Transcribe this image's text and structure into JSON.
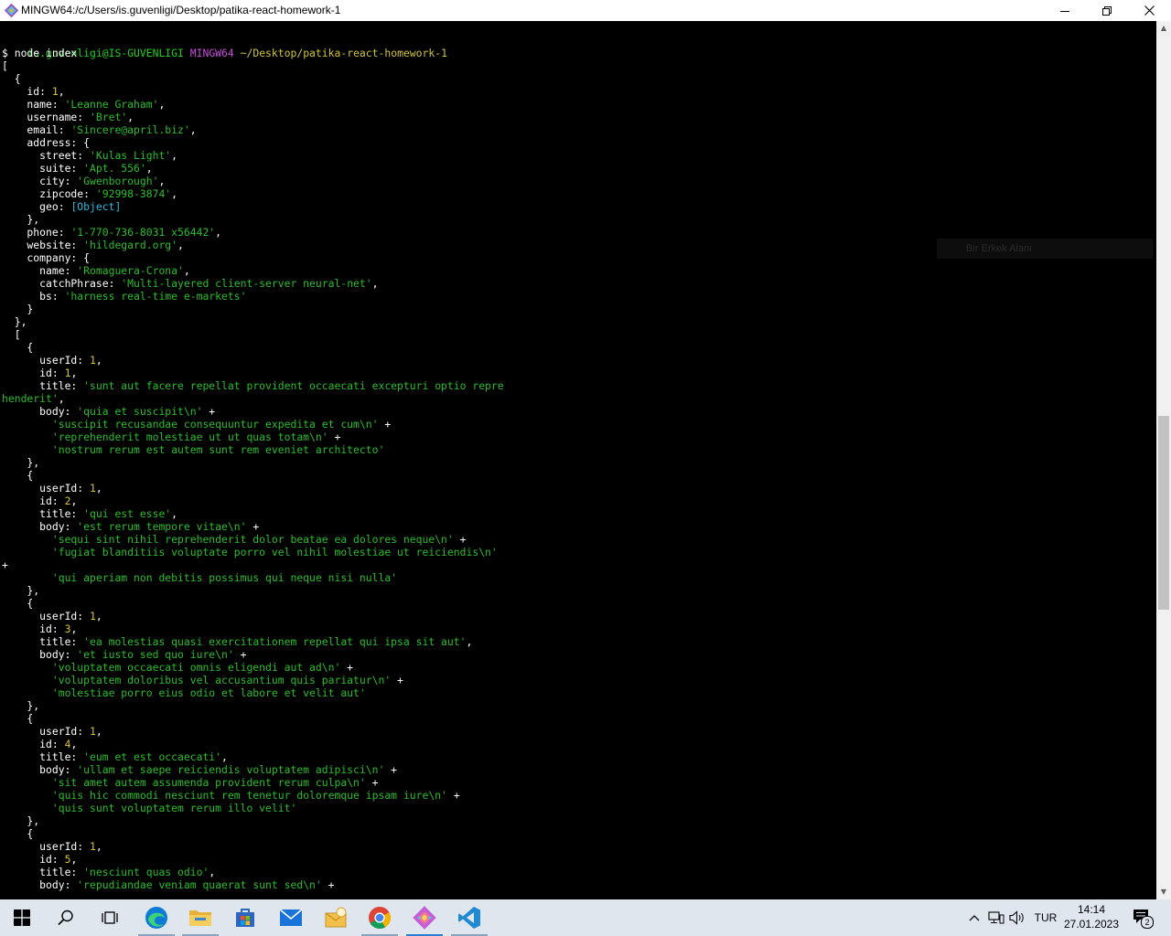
{
  "window": {
    "title": "MINGW64:/c/Users/is.guvenligi/Desktop/patika-react-homework-1",
    "minimize_icon": "minimize-icon",
    "maximize_icon": "restore-icon",
    "close_icon": "close-icon"
  },
  "terminal": {
    "prompt": {
      "user_host": "is.guvenligi@IS-GUVENLIGI",
      "shell": "MINGW64",
      "path": "~/Desktop/patika-react-homework-1"
    },
    "command": "$ node index",
    "lines": [
      [
        [
          "w",
          "["
        ]
      ],
      [
        [
          "w",
          "  {"
        ]
      ],
      [
        [
          "w",
          "    id: "
        ],
        [
          "n",
          "1"
        ],
        [
          "w",
          ","
        ]
      ],
      [
        [
          "w",
          "    name: "
        ],
        [
          "s",
          "'Leanne Graham'"
        ],
        [
          "w",
          ","
        ]
      ],
      [
        [
          "w",
          "    username: "
        ],
        [
          "s",
          "'Bret'"
        ],
        [
          "w",
          ","
        ]
      ],
      [
        [
          "w",
          "    email: "
        ],
        [
          "s",
          "'Sincere@april.biz'"
        ],
        [
          "w",
          ","
        ]
      ],
      [
        [
          "w",
          "    address: {"
        ]
      ],
      [
        [
          "w",
          "      street: "
        ],
        [
          "s",
          "'Kulas Light'"
        ],
        [
          "w",
          ","
        ]
      ],
      [
        [
          "w",
          "      suite: "
        ],
        [
          "s",
          "'Apt. 556'"
        ],
        [
          "w",
          ","
        ]
      ],
      [
        [
          "w",
          "      city: "
        ],
        [
          "s",
          "'Gwenborough'"
        ],
        [
          "w",
          ","
        ]
      ],
      [
        [
          "w",
          "      zipcode: "
        ],
        [
          "s",
          "'92998-3874'"
        ],
        [
          "w",
          ","
        ]
      ],
      [
        [
          "w",
          "      geo: "
        ],
        [
          "o",
          "[Object]"
        ]
      ],
      [
        [
          "w",
          "    },"
        ]
      ],
      [
        [
          "w",
          "    phone: "
        ],
        [
          "s",
          "'1-770-736-8031 x56442'"
        ],
        [
          "w",
          ","
        ]
      ],
      [
        [
          "w",
          "    website: "
        ],
        [
          "s",
          "'hildegard.org'"
        ],
        [
          "w",
          ","
        ]
      ],
      [
        [
          "w",
          "    company: {"
        ]
      ],
      [
        [
          "w",
          "      name: "
        ],
        [
          "s",
          "'Romaguera-Crona'"
        ],
        [
          "w",
          ","
        ]
      ],
      [
        [
          "w",
          "      catchPhrase: "
        ],
        [
          "s",
          "'Multi-layered client-server neural-net'"
        ],
        [
          "w",
          ","
        ]
      ],
      [
        [
          "w",
          "      bs: "
        ],
        [
          "s",
          "'harness real-time e-markets'"
        ]
      ],
      [
        [
          "w",
          "    }"
        ]
      ],
      [
        [
          "w",
          "  },"
        ]
      ],
      [
        [
          "w",
          "  ["
        ]
      ],
      [
        [
          "w",
          "    {"
        ]
      ],
      [
        [
          "w",
          "      userId: "
        ],
        [
          "n",
          "1"
        ],
        [
          "w",
          ","
        ]
      ],
      [
        [
          "w",
          "      id: "
        ],
        [
          "n",
          "1"
        ],
        [
          "w",
          ","
        ]
      ],
      [
        [
          "w",
          "      title: "
        ],
        [
          "s",
          "'sunt aut facere repellat provident occaecati excepturi optio repre"
        ]
      ],
      [
        [
          "s",
          "henderit'"
        ],
        [
          "w",
          ","
        ]
      ],
      [
        [
          "w",
          "      body: "
        ],
        [
          "s",
          "'quia et suscipit\\n'"
        ],
        [
          "w",
          " +"
        ]
      ],
      [
        [
          "s",
          "        'suscipit recusandae consequuntur expedita et cum\\n'"
        ],
        [
          "w",
          " +"
        ]
      ],
      [
        [
          "s",
          "        'reprehenderit molestiae ut ut quas totam\\n'"
        ],
        [
          "w",
          " +"
        ]
      ],
      [
        [
          "s",
          "        'nostrum rerum est autem sunt rem eveniet architecto'"
        ]
      ],
      [
        [
          "w",
          "    },"
        ]
      ],
      [
        [
          "w",
          "    {"
        ]
      ],
      [
        [
          "w",
          "      userId: "
        ],
        [
          "n",
          "1"
        ],
        [
          "w",
          ","
        ]
      ],
      [
        [
          "w",
          "      id: "
        ],
        [
          "n",
          "2"
        ],
        [
          "w",
          ","
        ]
      ],
      [
        [
          "w",
          "      title: "
        ],
        [
          "s",
          "'qui est esse'"
        ],
        [
          "w",
          ","
        ]
      ],
      [
        [
          "w",
          "      body: "
        ],
        [
          "s",
          "'est rerum tempore vitae\\n'"
        ],
        [
          "w",
          " +"
        ]
      ],
      [
        [
          "s",
          "        'sequi sint nihil reprehenderit dolor beatae ea dolores neque\\n'"
        ],
        [
          "w",
          " +"
        ]
      ],
      [
        [
          "s",
          "        'fugiat blanditiis voluptate porro vel nihil molestiae ut reiciendis\\n'"
        ]
      ],
      [
        [
          "w",
          "+"
        ]
      ],
      [
        [
          "s",
          "        'qui aperiam non debitis possimus qui neque nisi nulla'"
        ]
      ],
      [
        [
          "w",
          "    },"
        ]
      ],
      [
        [
          "w",
          "    {"
        ]
      ],
      [
        [
          "w",
          "      userId: "
        ],
        [
          "n",
          "1"
        ],
        [
          "w",
          ","
        ]
      ],
      [
        [
          "w",
          "      id: "
        ],
        [
          "n",
          "3"
        ],
        [
          "w",
          ","
        ]
      ],
      [
        [
          "w",
          "      title: "
        ],
        [
          "s",
          "'ea molestias quasi exercitationem repellat qui ipsa sit aut'"
        ],
        [
          "w",
          ","
        ]
      ],
      [
        [
          "w",
          "      body: "
        ],
        [
          "s",
          "'et iusto sed quo iure\\n'"
        ],
        [
          "w",
          " +"
        ]
      ],
      [
        [
          "s",
          "        'voluptatem occaecati omnis eligendi aut ad\\n'"
        ],
        [
          "w",
          " +"
        ]
      ],
      [
        [
          "s",
          "        'voluptatem doloribus vel accusantium quis pariatur\\n'"
        ],
        [
          "w",
          " +"
        ]
      ],
      [
        [
          "s",
          "        'molestiae porro eius odio et labore et velit aut'"
        ]
      ],
      [
        [
          "w",
          "    },"
        ]
      ],
      [
        [
          "w",
          "    {"
        ]
      ],
      [
        [
          "w",
          "      userId: "
        ],
        [
          "n",
          "1"
        ],
        [
          "w",
          ","
        ]
      ],
      [
        [
          "w",
          "      id: "
        ],
        [
          "n",
          "4"
        ],
        [
          "w",
          ","
        ]
      ],
      [
        [
          "w",
          "      title: "
        ],
        [
          "s",
          "'eum et est occaecati'"
        ],
        [
          "w",
          ","
        ]
      ],
      [
        [
          "w",
          "      body: "
        ],
        [
          "s",
          "'ullam et saepe reiciendis voluptatem adipisci\\n'"
        ],
        [
          "w",
          " +"
        ]
      ],
      [
        [
          "s",
          "        'sit amet autem assumenda provident rerum culpa\\n'"
        ],
        [
          "w",
          " +"
        ]
      ],
      [
        [
          "s",
          "        'quis hic commodi nesciunt rem tenetur doloremque ipsam iure\\n'"
        ],
        [
          "w",
          " +"
        ]
      ],
      [
        [
          "s",
          "        'quis sunt voluptatem rerum illo velit'"
        ]
      ],
      [
        [
          "w",
          "    },"
        ]
      ],
      [
        [
          "w",
          "    {"
        ]
      ],
      [
        [
          "w",
          "      userId: "
        ],
        [
          "n",
          "1"
        ],
        [
          "w",
          ","
        ]
      ],
      [
        [
          "w",
          "      id: "
        ],
        [
          "n",
          "5"
        ],
        [
          "w",
          ","
        ]
      ],
      [
        [
          "w",
          "      title: "
        ],
        [
          "s",
          "'nesciunt quas odio'"
        ],
        [
          "w",
          ","
        ]
      ],
      [
        [
          "w",
          "      body: "
        ],
        [
          "s",
          "'repudiandae veniam quaerat sunt sed\\n'"
        ],
        [
          "w",
          " +"
        ]
      ]
    ],
    "ghost_overlay": "Bir Erkek Alanı",
    "scrollbar": {
      "scroll_position_fraction": 0.58,
      "up_icon": "arrow-up-icon",
      "down_icon": "arrow-down-icon"
    }
  },
  "taskbar": {
    "apps": [
      {
        "name": "start-button",
        "icon": "windows-logo-icon"
      },
      {
        "name": "search-button",
        "icon": "search-icon"
      },
      {
        "name": "task-view-button",
        "icon": "task-view-icon"
      },
      {
        "name": "edge-button",
        "icon": "edge-icon"
      },
      {
        "name": "file-explorer-button",
        "icon": "folder-icon"
      },
      {
        "name": "store-button",
        "icon": "store-icon"
      },
      {
        "name": "mail-button",
        "icon": "mail-icon"
      },
      {
        "name": "sticky-app-button",
        "icon": "envelope-app-icon"
      },
      {
        "name": "chrome-button",
        "icon": "chrome-icon"
      },
      {
        "name": "git-bash-button",
        "icon": "git-icon"
      },
      {
        "name": "vscode-button",
        "icon": "vscode-icon"
      }
    ],
    "tray": {
      "language": "TUR",
      "time": "14:14",
      "date": "27.01.2023",
      "notification_count": "2"
    },
    "colors": {
      "taskbar_bg": "#dfe6ee",
      "active_indicator": "#2b7cd3"
    }
  },
  "colors": {
    "terminal_bg": "#000000",
    "user_host": "#1fd11f",
    "shell": "#c64fd9",
    "path": "#d1c43a",
    "string": "#2bbd2b",
    "number": "#d8c237",
    "object_ref": "#29b8db",
    "plain": "#ffffff"
  }
}
